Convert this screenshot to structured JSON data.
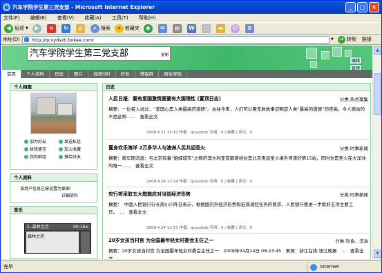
{
  "window": {
    "title": "汽车学院学生第三党支部 - Microsoft Internet Explorer"
  },
  "menu": [
    "文件(F)",
    "编辑(E)",
    "查看(V)",
    "收藏(A)",
    "工具(T)",
    "帮助(H)"
  ],
  "toolbar": {
    "back": "后退",
    "search": "搜索",
    "favorites": "收藏夹"
  },
  "address": {
    "label": "地址(D)",
    "url": "http://qcxydszb.bokee.com/",
    "go": "转到",
    "links": "链接"
  },
  "status": {
    "left": "完毕",
    "zone": "Internet"
  },
  "site": {
    "title": "汽车学院学生第三党支部",
    "copy": "复制",
    "edit": "编辑",
    "manage": "管理",
    "nav": [
      "首页",
      "个人资料",
      "日志",
      "图片",
      "视频(测)",
      "好友",
      "博客群",
      "网址导航"
    ]
  },
  "sidebar": {
    "profile_header": "个人档案",
    "actions": [
      "加为好友",
      "发送私信",
      "给我留言",
      "加入收藏",
      "我的群组",
      "推给好友"
    ],
    "info_header": "个人资料",
    "info_text": "该用户信息已被设置为保密!",
    "info_link": "详细资料",
    "music_header": "音乐",
    "player_track": "1. 森林之月",
    "player_time": "00:16",
    "player_list_item": "森林之月"
  },
  "main": {
    "header": "日志",
    "posts": [
      {
        "title": "人民日报：要有爱国激情更要有大国理性 (置顶日志)",
        "category": "分类:热点聚集",
        "summary": "摘要：一位名人说过，“爱国心是人类最高的道德”。古往今来，人们可以用无数故事证明这人类“最高的道德”的崇高。今人感动的不是这种……　查看全文",
        "meta": "2008.4.21 15:10 作者：qcxydszb 引用：0 | 收藏 | 评论：0"
      },
      {
        "title": "置身欢乐海洋 2万多华人与澳洲人民共迎圣火",
        "category": "分类:时事新闻",
        "summary": "摘要：新华网消息：与北京有着“姐妹城市”之称的澳大利亚首都堪培拉是北京奥运圣火境外传递的第15站，同时也是圣火在大洋洲的唯一……　查看全文",
        "meta": "2008.4.24 12:54 作者：qcxydszb 引用：0 | 收藏 | 评论：0"
      },
      {
        "title": "央行将采取五大措施应对当前经济形势",
        "category": "分类:时事新闻",
        "summary": "摘要：　中国人民银行行长周小川昨日表示，根据国内外经济形势和宏观调控任务的要求，人民银行要进一步抓好五项主要工作。　…　查看全文",
        "meta": "2008.4.24 11:53 作者：qcxydszb 引用：0 | 收藏 | 评论：0"
      },
      {
        "title": "20岁女孩当村官 为全国最年轻女村委会主任之一",
        "category": "分类:社会、法治",
        "summary": "摘要：20岁女孩当村官 为全国最年轻女村委会主任之一　2008年04月24日 08:23:45　来源：浙江在线-钱江晚报　…　查看全文",
        "meta": ""
      }
    ]
  }
}
